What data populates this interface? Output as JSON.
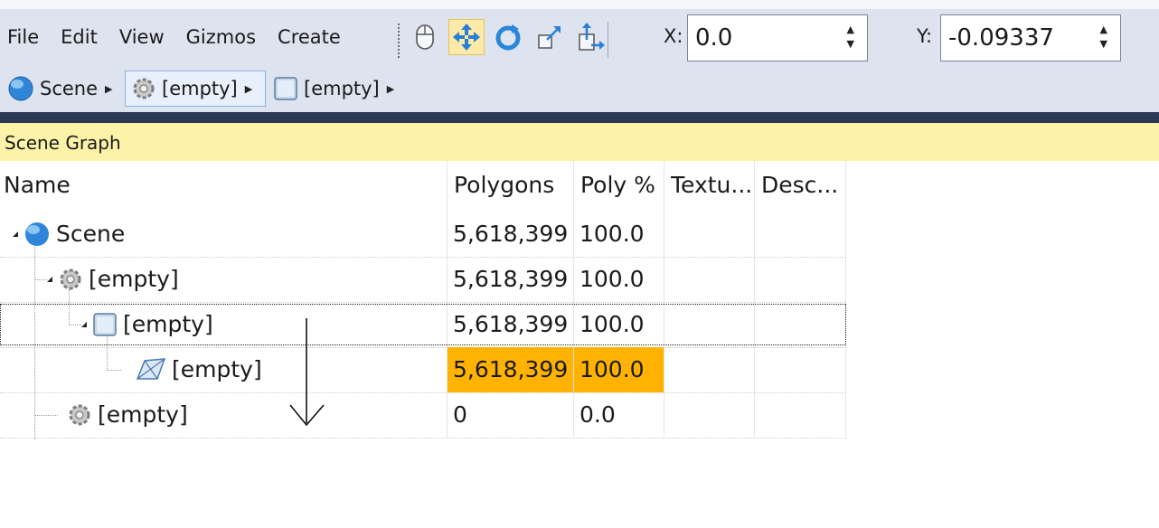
{
  "menu": {
    "items": [
      "File",
      "Edit",
      "View",
      "Gizmos",
      "Create"
    ]
  },
  "coords": {
    "x_label": "X:",
    "x_value": "0.0",
    "y_label": "Y:",
    "y_value": "-0.09337"
  },
  "breadcrumb": {
    "items": [
      {
        "label": "Scene",
        "icon": "globe-icon"
      },
      {
        "label": "[empty]",
        "icon": "gear-icon",
        "selected": true
      },
      {
        "label": "[empty]",
        "icon": "box-icon"
      }
    ]
  },
  "panel": {
    "title": "Scene Graph"
  },
  "table": {
    "headers": [
      "Name",
      "Polygons",
      "Poly %",
      "Textu...",
      "Desc..."
    ],
    "rows": [
      {
        "name": "Scene",
        "icon": "globe-icon",
        "polygons": "5,618,399",
        "poly_pct": "100.0",
        "highlight": false
      },
      {
        "name": "[empty]",
        "icon": "gear-icon",
        "polygons": "5,618,399",
        "poly_pct": "100.0",
        "highlight": false
      },
      {
        "name": "[empty]",
        "icon": "box-icon",
        "polygons": "5,618,399",
        "poly_pct": "100.0",
        "highlight": false
      },
      {
        "name": "[empty]",
        "icon": "mesh-icon",
        "polygons": "5,618,399",
        "poly_pct": "100.0",
        "highlight": true
      },
      {
        "name": "[empty]",
        "icon": "gear-icon",
        "polygons": "0",
        "poly_pct": "0.0",
        "highlight": false
      }
    ]
  },
  "colors": {
    "toolbar_bg": "#dde3ef",
    "panel_title_bg": "#fdf3a8",
    "highlight": "#ffb300",
    "active_tool": "#fde9a8"
  }
}
